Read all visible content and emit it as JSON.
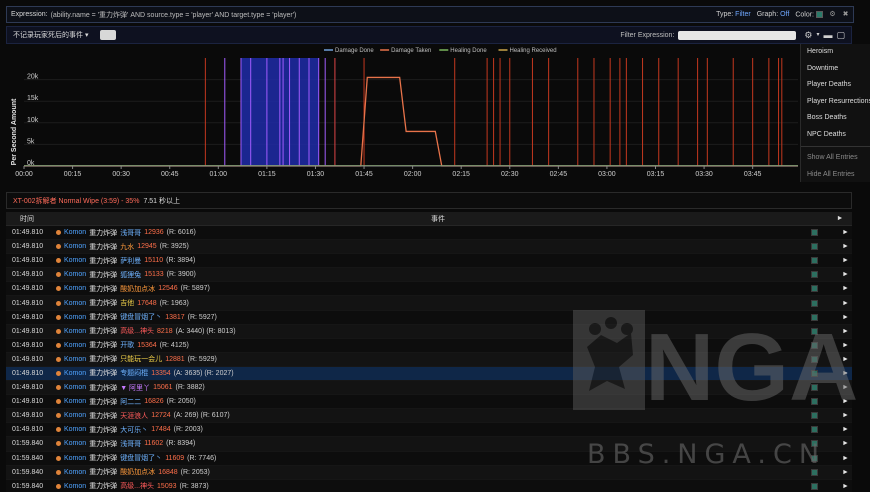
{
  "expression": {
    "label": "Expression:",
    "text": "(ability.name = '重力炸弹' AND source.type = 'player' AND target.type = 'player')",
    "type_label": "Type:",
    "type_value": "Filter",
    "graph_label": "Graph:",
    "graph_value": "Off",
    "color_label": "Color:"
  },
  "toolbar": {
    "dropdown_label": "不记录玩家死后的事件 ▾",
    "filter_label": "Filter Expression:"
  },
  "chart_data": {
    "type": "line",
    "ylabel": "Per Second Amount",
    "y_ticks": [
      "0k",
      "5k",
      "10k",
      "15k",
      "20k"
    ],
    "ylim": [
      0,
      25000
    ],
    "x_ticks": [
      "00:00",
      "00:15",
      "00:30",
      "00:45",
      "01:00",
      "01:15",
      "01:30",
      "01:45",
      "02:00",
      "02:15",
      "02:30",
      "02:45",
      "03:00",
      "03:15",
      "03:30",
      "03:45"
    ],
    "x_range_seconds": [
      0,
      239
    ],
    "legend": [
      "Damage Done",
      "Damage Taken",
      "Healing Done",
      "Healing Received"
    ],
    "legend_colors": [
      "#6fa0d8",
      "#e8734a",
      "#7ab65c",
      "#caa54a"
    ],
    "series": [
      {
        "name": "Damage Taken",
        "color": "#e8734a",
        "x": [
          0,
          104,
          106,
          116,
          118,
          127,
          129,
          239
        ],
        "y": [
          0,
          0,
          20500,
          20500,
          8000,
          8000,
          0,
          0
        ]
      }
    ],
    "highlight_range_seconds": [
      67,
      91
    ],
    "event_markers_purple_seconds": [
      62,
      67,
      70,
      75,
      79,
      80,
      82,
      85,
      88,
      91,
      93,
      96
    ],
    "event_markers_red_seconds": [
      56,
      96,
      105,
      133,
      143,
      145,
      147,
      150,
      157,
      162,
      171,
      176,
      181,
      184,
      186,
      191,
      196,
      202,
      208,
      211,
      219,
      225,
      230,
      233,
      234
    ]
  },
  "menu": {
    "items": [
      "Heroism",
      "Downtime",
      "Player Deaths",
      "Player Resurrections",
      "Boss Deaths",
      "NPC Deaths"
    ],
    "footer_items": [
      "Show All Entries",
      "Hide All Entries"
    ]
  },
  "encounter": {
    "title": "XT-002拆解者 Normal Wipe (3:59) - 35%",
    "duration": "7.51 秒以上"
  },
  "table": {
    "col_time": "时间",
    "col_event": "事件",
    "rows": [
      {
        "time": "01:49.810",
        "source": "Komon",
        "ability": "重力炸弹",
        "target": "浅哥哥",
        "color": "tgt",
        "amount": "12936",
        "extra": "(R: 6016)"
      },
      {
        "time": "01:49.810",
        "source": "Komon",
        "ability": "重力炸弹",
        "target": "九水",
        "color": "tgt o",
        "amount": "12945",
        "extra": "(R: 3925)"
      },
      {
        "time": "01:49.810",
        "source": "Komon",
        "ability": "重力炸弹",
        "target": "萨利曼",
        "color": "tgt",
        "amount": "15110",
        "extra": "(R: 3894)"
      },
      {
        "time": "01:49.810",
        "source": "Komon",
        "ability": "重力炸弹",
        "target": "狐狸兔",
        "color": "tgt",
        "amount": "15133",
        "extra": "(R: 3900)"
      },
      {
        "time": "01:49.810",
        "source": "Komon",
        "ability": "重力炸弹",
        "target": "酸奶加点冰",
        "color": "tgt o",
        "amount": "12546",
        "extra": "(R: 5897)"
      },
      {
        "time": "01:49.810",
        "source": "Komon",
        "ability": "重力炸弹",
        "target": "吉他",
        "color": "tgt g",
        "amount": "17648",
        "extra": "(R: 1963)"
      },
      {
        "time": "01:49.810",
        "source": "Komon",
        "ability": "重力炸弹",
        "target": "键盘冒烟了丶",
        "color": "tgt",
        "amount": "13817",
        "extra": "(R: 5927)"
      },
      {
        "time": "01:49.810",
        "source": "Komon",
        "ability": "重力炸弹",
        "target": "高级...神头",
        "color": "tgt r",
        "amount": "8218",
        "extra": "(A: 3440) (R: 8013)"
      },
      {
        "time": "01:49.810",
        "source": "Komon",
        "ability": "重力炸弹",
        "target": "开歌",
        "color": "tgt",
        "amount": "15364",
        "extra": "(R: 4125)"
      },
      {
        "time": "01:49.810",
        "source": "Komon",
        "ability": "重力炸弹",
        "target": "只能玩一会儿",
        "color": "tgt g",
        "amount": "12881",
        "extra": "(R: 5929)"
      },
      {
        "time": "01:49.810",
        "source": "Komon",
        "ability": "重力炸弹",
        "target": "专题闷棍",
        "color": "tgt",
        "amount": "13354",
        "extra": "(A: 3635) (R: 2027)",
        "hl": true
      },
      {
        "time": "01:49.810",
        "source": "Komon",
        "ability": "重力炸弹",
        "target": "▼ 阿里丫",
        "color": "tgt p",
        "amount": "15061",
        "extra": "(R: 3882)"
      },
      {
        "time": "01:49.810",
        "source": "Komon",
        "ability": "重力炸弹",
        "target": "阿二二",
        "color": "tgt",
        "amount": "16826",
        "extra": "(R: 2050)"
      },
      {
        "time": "01:49.810",
        "source": "Komon",
        "ability": "重力炸弹",
        "target": "天涯浪人",
        "color": "tgt r",
        "amount": "12724",
        "extra": "(A: 269) (R: 6107)"
      },
      {
        "time": "01:49.810",
        "source": "Komon",
        "ability": "重力炸弹",
        "target": "大可乐丶",
        "color": "tgt",
        "amount": "17484",
        "extra": "(R: 2003)"
      },
      {
        "time": "01:59.840",
        "source": "Komon",
        "ability": "重力炸弹",
        "target": "浅哥哥",
        "color": "tgt",
        "amount": "11602",
        "extra": "(R: 8394)"
      },
      {
        "time": "01:59.840",
        "source": "Komon",
        "ability": "重力炸弹",
        "target": "键盘冒烟了丶",
        "color": "tgt",
        "amount": "11609",
        "extra": "(R: 7746)"
      },
      {
        "time": "01:59.840",
        "source": "Komon",
        "ability": "重力炸弹",
        "target": "酸奶加点冰",
        "color": "tgt o",
        "amount": "16848",
        "extra": "(R: 2053)"
      },
      {
        "time": "01:59.840",
        "source": "Komon",
        "ability": "重力炸弹",
        "target": "高级...神头",
        "color": "tgt r",
        "amount": "15093",
        "extra": "(R: 3873)"
      }
    ]
  },
  "watermark": {
    "logo_text": "NGA",
    "site_text": "BBS.NGA.CN"
  }
}
